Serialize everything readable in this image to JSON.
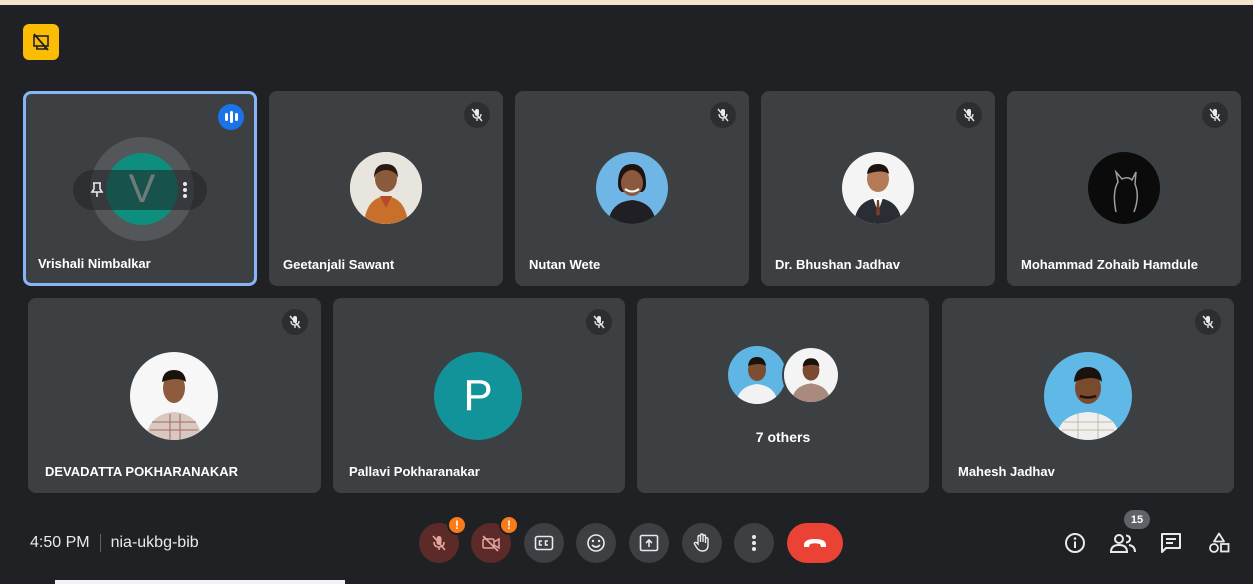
{
  "meeting": {
    "time": "4:50 PM",
    "code": "nia-ukbg-bib",
    "participant_count": "15"
  },
  "participants": [
    {
      "name": "Vrishali Nimbalkar",
      "initial": "V",
      "speaking": true,
      "color": "#0e8f7d"
    },
    {
      "name": "Geetanjali Sawant",
      "muted": true
    },
    {
      "name": "Nutan Wete",
      "muted": true
    },
    {
      "name": "Dr. Bhushan Jadhav",
      "muted": true
    },
    {
      "name": "Mohammad Zohaib Hamdule",
      "muted": true
    },
    {
      "name": "DEVADATTA POKHARANAKAR",
      "muted": true
    },
    {
      "name": "Pallavi Pokharanakar",
      "initial": "P",
      "muted": true,
      "color": "#12939a"
    },
    {
      "name": "",
      "others_label": "7 others"
    },
    {
      "name": "Mahesh Jadhav",
      "muted": true
    }
  ],
  "controls": {
    "mic": "mic-off-icon",
    "camera": "camera-off-icon",
    "captions": "CC",
    "emoji": "emoji-icon",
    "present": "present-icon",
    "raise_hand": "hand-icon",
    "more": "more-options-icon",
    "hangup": "end-call-icon",
    "warning_mark": "!"
  },
  "colors": {
    "background": "#202124",
    "tile": "#3c4043",
    "active_border": "#8ab4f8",
    "hangup": "#ea4335",
    "badge": "#fbbc04"
  }
}
